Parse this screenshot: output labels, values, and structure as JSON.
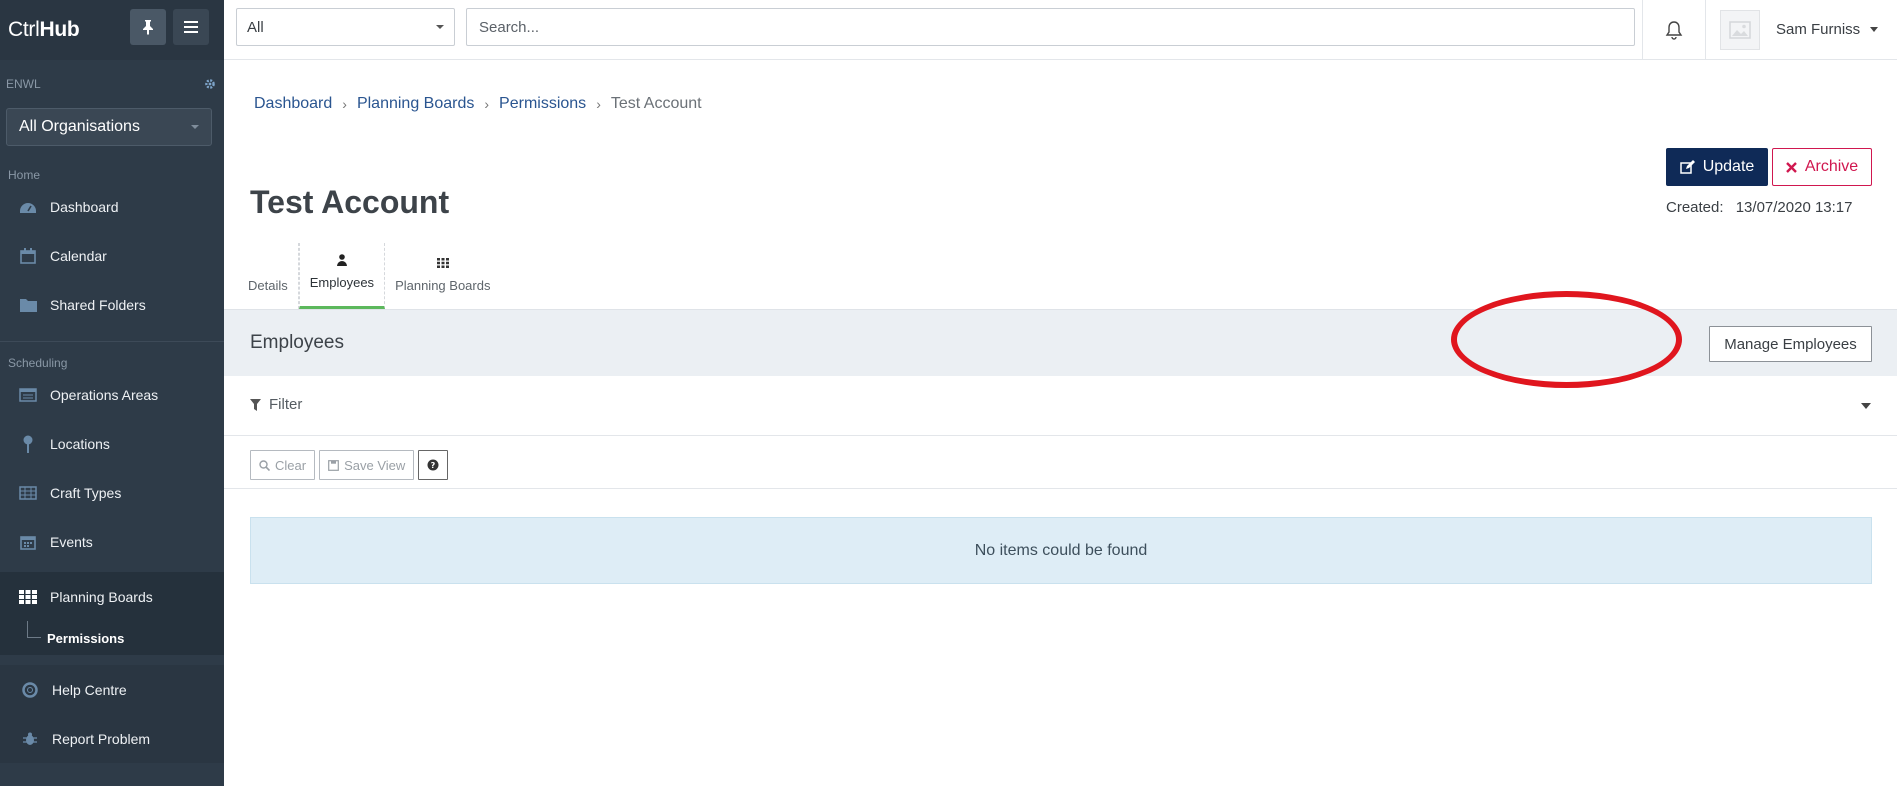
{
  "brand": {
    "prefix": "Ctrl",
    "suffix": "Hub"
  },
  "sidebar": {
    "org_code": "ENWL",
    "org_select": "All Organisations",
    "sections": {
      "home": "Home",
      "scheduling": "Scheduling"
    },
    "home_items": [
      {
        "label": "Dashboard",
        "icon": "dashboard-icon"
      },
      {
        "label": "Calendar",
        "icon": "calendar-icon"
      },
      {
        "label": "Shared Folders",
        "icon": "folder-icon"
      }
    ],
    "scheduling_items": [
      {
        "label": "Operations Areas",
        "icon": "operations-icon"
      },
      {
        "label": "Locations",
        "icon": "location-pin-icon"
      },
      {
        "label": "Craft Types",
        "icon": "table-icon"
      },
      {
        "label": "Events",
        "icon": "calendar-icon"
      },
      {
        "label": "Planning Boards",
        "icon": "grid-icon"
      }
    ],
    "sub_item": "Permissions",
    "bottom_items": [
      {
        "label": "Help Centre",
        "icon": "lifebuoy-icon"
      },
      {
        "label": "Report Problem",
        "icon": "bug-icon"
      }
    ]
  },
  "topbar": {
    "scope": "All",
    "search_placeholder": "Search...",
    "user_name": "Sam Furniss"
  },
  "breadcrumb": [
    "Dashboard",
    "Planning Boards",
    "Permissions",
    "Test Account"
  ],
  "page": {
    "title": "Test Account",
    "update_label": "Update",
    "archive_label": "Archive",
    "created_label": "Created:",
    "created_value": "13/07/2020 13:17"
  },
  "tabs": [
    {
      "label": "Details",
      "icon": ""
    },
    {
      "label": "Employees",
      "icon": "user-icon"
    },
    {
      "label": "Planning Boards",
      "icon": "grid-icon"
    }
  ],
  "panel": {
    "title": "Employees",
    "manage_label": "Manage Employees",
    "filter_label": "Filter",
    "clear_label": "Clear",
    "save_view_label": "Save View",
    "empty_message": "No items could be found"
  },
  "colors": {
    "sidebar_bg": "#2e3b48",
    "primary": "#0f2a57",
    "danger": "#d0174f",
    "tab_active": "#5cb85c",
    "highlight": "#e0161e"
  }
}
